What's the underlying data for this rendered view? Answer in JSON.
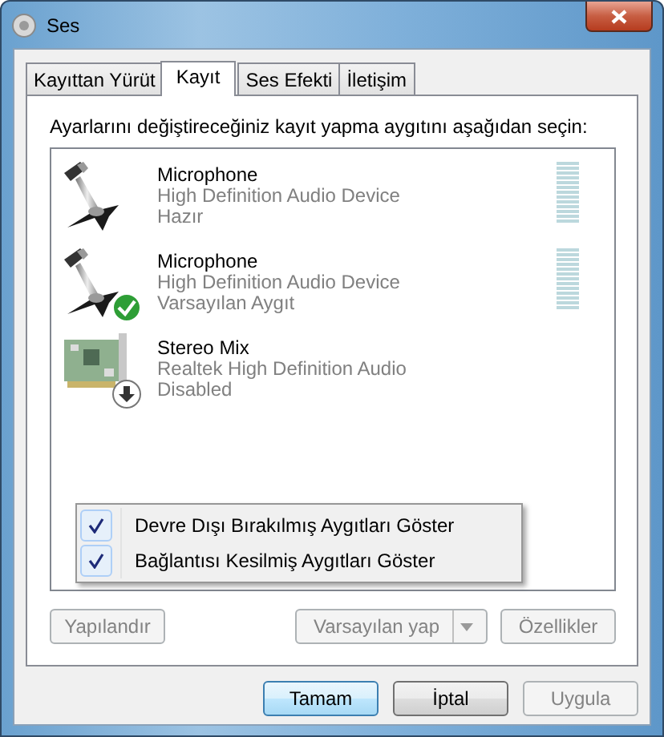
{
  "window": {
    "title": "Ses"
  },
  "tabs": [
    {
      "label": "Kayıttan Yürüt",
      "selected": false
    },
    {
      "label": "Kayıt",
      "selected": true
    },
    {
      "label": "Ses Efekti",
      "selected": false
    },
    {
      "label": "İletişim",
      "selected": false
    }
  ],
  "instruction": "Ayarlarını değiştireceğiniz kayıt yapma aygıtını aşağıdan seçin:",
  "devices": [
    {
      "kind": "microphone",
      "name": "Microphone",
      "driver": "High Definition Audio Device",
      "status": "Hazır",
      "default": false,
      "disabled": false
    },
    {
      "kind": "microphone",
      "name": "Microphone",
      "driver": "High Definition Audio Device",
      "status": "Varsayılan Aygıt",
      "default": true,
      "disabled": false
    },
    {
      "kind": "sound-card",
      "name": "Stereo Mix",
      "driver": "Realtek High Definition Audio",
      "status": "Disabled",
      "default": false,
      "disabled": true
    }
  ],
  "context_menu": [
    {
      "label": "Devre Dışı Bırakılmış Aygıtları Göster",
      "checked": true
    },
    {
      "label": "Bağlantısı Kesilmiş Aygıtları Göster",
      "checked": true
    }
  ],
  "tab_buttons": [
    {
      "label": "Yapılandır",
      "kind": "plain",
      "disabled": true
    },
    {
      "label": "Varsayılan yap",
      "kind": "split",
      "disabled": true
    },
    {
      "label": "Özellikler",
      "kind": "plain",
      "disabled": true
    }
  ],
  "dialog_buttons": [
    {
      "label": "Tamam",
      "default": true,
      "disabled": false
    },
    {
      "label": "İptal",
      "default": false,
      "disabled": false
    },
    {
      "label": "Uygula",
      "default": false,
      "disabled": true
    }
  ]
}
